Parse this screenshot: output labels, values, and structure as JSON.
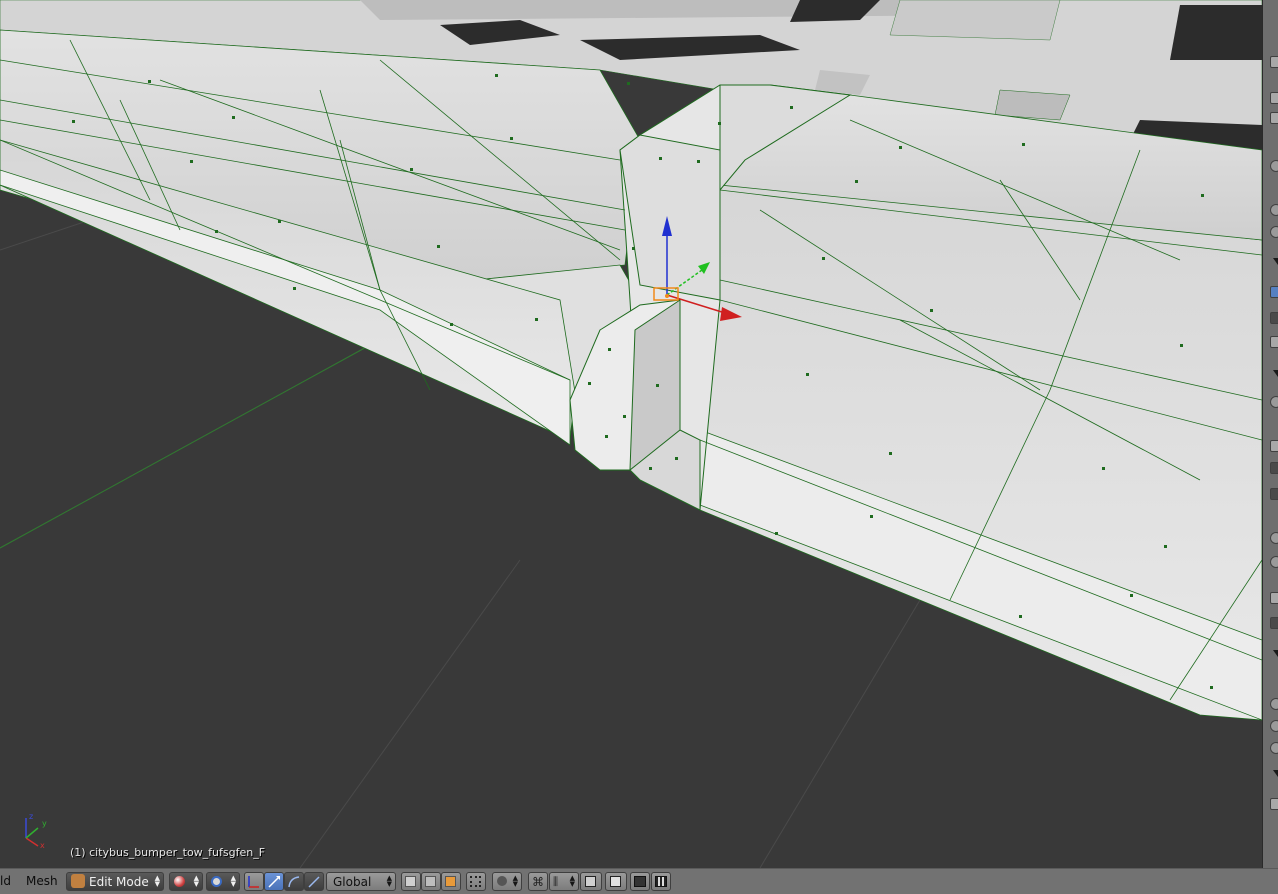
{
  "viewport": {
    "object_info": "(1) citybus_bumper_tow_fufsgfen_F",
    "axes": {
      "x": "x",
      "y": "y",
      "z": "z"
    }
  },
  "header": {
    "view_label": "ld",
    "mesh_menu": "Mesh",
    "mode": {
      "label": "Edit Mode",
      "icon": "edit-mode-icon"
    },
    "shading": {
      "icon": "shading-sphere-icon"
    },
    "pivot": {
      "icon": "pivot-point-icon"
    },
    "manipulators": [
      "translate-manipulator-icon",
      "rotate-manipulator-icon",
      "scale-manipulator-icon"
    ],
    "orientation": "Global",
    "select_modes": [
      "vertex-select-icon",
      "edge-select-icon",
      "face-select-icon"
    ],
    "limit_selection": "occlude-icon",
    "proportional_edit": "proportional-edit-icon",
    "snap": [
      "snap-toggle-icon",
      "snap-element-icon",
      "snap-target-icon"
    ],
    "render": [
      "render-still-icon",
      "render-animation-icon"
    ]
  },
  "colors": {
    "accent": "#5680c2",
    "wire": "#1f6b1f",
    "mesh": "#e4e4e4",
    "background": "#393939",
    "header": "#727272"
  }
}
